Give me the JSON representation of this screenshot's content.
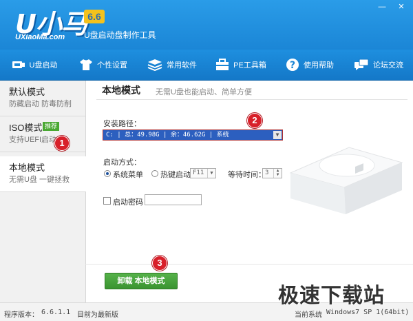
{
  "header": {
    "logo_text": "U小马",
    "version": "6.6",
    "subtitle": "U盘启动盘制作工具",
    "domain": "UXiaoMa.com"
  },
  "toolbar": {
    "items": [
      {
        "label": "U盘启动",
        "icon": "usb-icon"
      },
      {
        "label": "个性设置",
        "icon": "tshirt-icon"
      },
      {
        "label": "常用软件",
        "icon": "stack-icon"
      },
      {
        "label": "PE工具箱",
        "icon": "toolbox-icon"
      },
      {
        "label": "使用帮助",
        "icon": "help-icon"
      },
      {
        "label": "论坛交流",
        "icon": "chat-icon"
      }
    ]
  },
  "sidebar": {
    "items": [
      {
        "title": "默认模式",
        "desc": "防藏启动 防毒防削",
        "active": false
      },
      {
        "title": "ISO模式",
        "badge": "推荐",
        "desc": "支持UEFI启动",
        "active": false
      },
      {
        "title": "本地模式",
        "desc": "无需U盘 一键拯救",
        "active": true
      }
    ]
  },
  "main": {
    "title": "本地模式",
    "subtitle": "无需U盘也能启动、简单方便",
    "install_path_label": "安装路径：",
    "install_path_value": "C: | 总：49.98G | 余：46.62G | 系统",
    "boot_method_label": "启动方式：",
    "boot_option_system": "系统菜单",
    "boot_option_hotkey": "热键启动",
    "hotkey_value": "F11",
    "wait_time_label": "等待时间：",
    "wait_time_value": "3",
    "boot_password_label": "启动密码",
    "boot_password_value": "",
    "action_button": "卸载 本地模式"
  },
  "markers": [
    "1",
    "2",
    "3"
  ],
  "status": {
    "version_label": "程序版本：",
    "version_value": "6.6.1.1",
    "update_status": "目前为最新版",
    "system_label": "当前系统",
    "system_value": "Windows7 SP 1(64bit)"
  },
  "watermark": "极速下载站",
  "colors": {
    "header_blue": "#1b86d6",
    "toolbar_blue": "#1478c8",
    "action_green": "#3a9430",
    "marker_red": "#d8202a",
    "selection_blue": "#2c5fbf"
  }
}
